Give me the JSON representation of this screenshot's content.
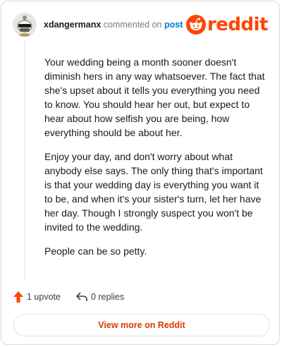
{
  "header": {
    "username": "xdangermanx",
    "action_text": "commented on",
    "target_text": "post",
    "logo_text": "reddit"
  },
  "comment": {
    "paragraphs": [
      "Your wedding being a month sooner doesn't diminish hers in any way whatsoever. The fact that she's upset about it tells you everything you need to know. You should hear her out, but expect to hear about how selfish you are being, how everything should be about her.",
      "Enjoy your day, and don't worry about what anybody else says. The only thing that's important is that your wedding day is everything you want it to be, and when it's your sister's turn, let her have her day. Though I strongly suspect you won't be invited to the wedding.",
      "People can be so petty."
    ]
  },
  "actions": {
    "upvote_label": "1 upvote",
    "replies_label": "0 replies"
  },
  "footer": {
    "view_more_label": "View more on Reddit"
  },
  "colors": {
    "brand": "#ff4500",
    "link": "#0079d3",
    "view_more": "#d93a00"
  },
  "icons": {
    "avatar": "snoo-avatar",
    "logo": "reddit-snoo-icon",
    "upvote": "upvote-arrow-icon",
    "reply": "reply-arrow-icon"
  }
}
